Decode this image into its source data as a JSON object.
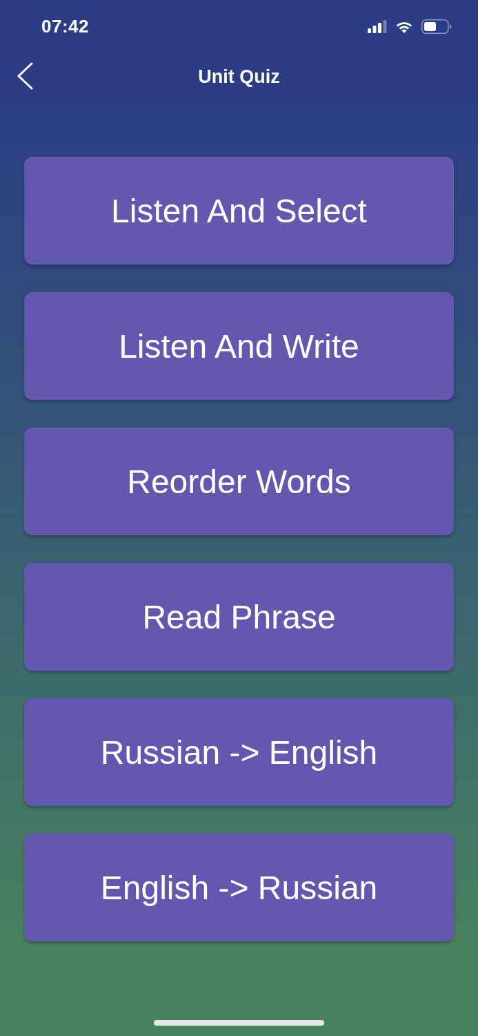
{
  "status_bar": {
    "time": "07:42"
  },
  "nav_bar": {
    "title": "Unit Quiz"
  },
  "quiz_options": [
    {
      "label": "Listen And Select"
    },
    {
      "label": "Listen And Write"
    },
    {
      "label": "Reorder Words"
    },
    {
      "label": "Read Phrase"
    },
    {
      "label": "Russian -> English"
    },
    {
      "label": "English -> Russian"
    }
  ]
}
